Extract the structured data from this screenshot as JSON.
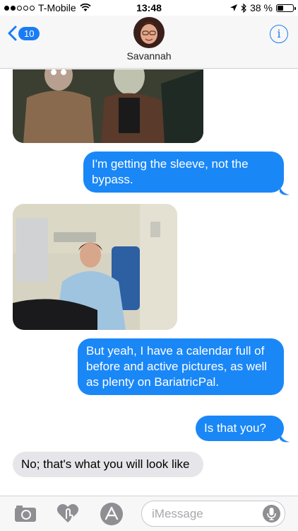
{
  "status_bar": {
    "carrier": "T-Mobile",
    "time": "13:48",
    "battery_text": "38 %",
    "battery_level": 0.38
  },
  "header": {
    "back_badge": "10",
    "contact_name": "Savannah",
    "info_label": "i"
  },
  "messages": [
    {
      "kind": "image",
      "side": "in",
      "description_icon": "photo-icon"
    },
    {
      "kind": "text",
      "side": "out",
      "text": "I'm getting the sleeve, not the bypass."
    },
    {
      "kind": "image",
      "side": "in",
      "description_icon": "photo-icon"
    },
    {
      "kind": "text",
      "side": "out",
      "text": "But yeah, I have a calendar full of before and active pictures, as well as plenty on BariatricPal."
    },
    {
      "kind": "text",
      "side": "out",
      "text": "Is that you?"
    },
    {
      "kind": "text",
      "side": "in",
      "text": "No; that's what you will look like"
    }
  ],
  "input_bar": {
    "placeholder": "iMessage",
    "icons": [
      "camera-icon",
      "digital-touch-icon",
      "app-store-icon",
      "microphone-icon"
    ]
  },
  "colors": {
    "accent": "#1a7cf5",
    "outgoing_bubble": "#1a87f7",
    "incoming_bubble": "#e5e5ea"
  }
}
